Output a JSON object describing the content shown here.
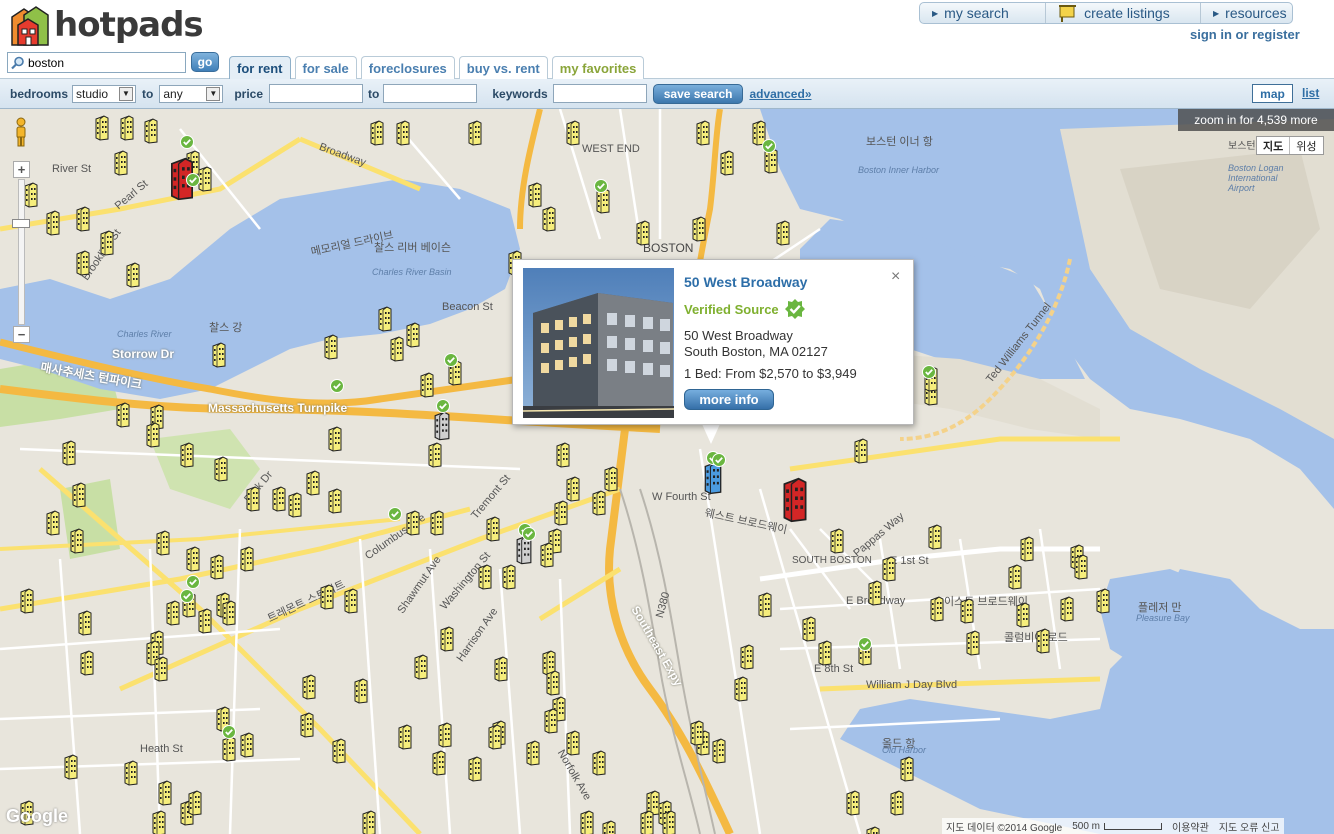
{
  "brand": {
    "name": "hotpads"
  },
  "topnav": {
    "items": [
      {
        "label": "my search"
      },
      {
        "label": "create listings"
      },
      {
        "label": "resources"
      }
    ],
    "signin": "sign in or register"
  },
  "search": {
    "value": "boston",
    "go_label": "go"
  },
  "tabs": [
    {
      "label": "for rent",
      "active": true
    },
    {
      "label": "for sale"
    },
    {
      "label": "foreclosures"
    },
    {
      "label": "buy vs. rent"
    },
    {
      "label": "my favorites"
    }
  ],
  "filters": {
    "bedrooms_label": "bedrooms",
    "bedrooms_from": "studio",
    "to_label": "to",
    "bedrooms_to": "any",
    "price_label": "price",
    "price_to_label": "to",
    "keywords_label": "keywords",
    "save_search_label": "save search",
    "advanced_label": "advanced»",
    "view_map_label": "map",
    "view_list_label": "list"
  },
  "map": {
    "zoom_message": "zoom in for 4,539 more",
    "map_type": {
      "map": "지도",
      "satellite": "위성"
    },
    "google": "Google",
    "attribution": "지도 데이터 ©2014 Google",
    "scale": "500 m",
    "terms": "이용약관",
    "report": "지도 오류 신고",
    "labels": [
      {
        "text": "BOSTON",
        "cls": "big"
      },
      {
        "text": "WEST END",
        "cls": ""
      },
      {
        "text": "SOUTH BOSTON",
        "cls": ""
      },
      {
        "text": "Charles River Basin",
        "cls": "water"
      },
      {
        "text": "찰스 리버 베이슨",
        "cls": ""
      },
      {
        "text": "Charles River",
        "cls": "water"
      },
      {
        "text": "찰스 강",
        "cls": ""
      },
      {
        "text": "보스턴 이너 항",
        "cls": ""
      },
      {
        "text": "Boston Inner Harbor",
        "cls": "water"
      },
      {
        "text": "보스턴 로건 국제공항",
        "cls": ""
      },
      {
        "text": "Boston Logan International Airport",
        "cls": "water"
      },
      {
        "text": "플레저 만",
        "cls": ""
      },
      {
        "text": "Pleasure Bay",
        "cls": "water"
      },
      {
        "text": "올드 항",
        "cls": ""
      },
      {
        "text": "Old Harbor",
        "cls": "water"
      },
      {
        "text": "Storrow Dr",
        "cls": "white"
      },
      {
        "text": "Massachusetts Turnpike",
        "cls": "white"
      },
      {
        "text": "Southeast Expy",
        "cls": "white"
      },
      {
        "text": "Ted Williams Tunnel",
        "cls": ""
      },
      {
        "text": "W Fourth St",
        "cls": ""
      },
      {
        "text": "E Broadway",
        "cls": ""
      },
      {
        "text": "E 1st St",
        "cls": ""
      },
      {
        "text": "E 8th St",
        "cls": ""
      },
      {
        "text": "William J Day Blvd",
        "cls": ""
      },
      {
        "text": "Pappas Way",
        "cls": ""
      },
      {
        "text": "Beacon St",
        "cls": ""
      },
      {
        "text": "Broadway",
        "cls": ""
      },
      {
        "text": "Heath St",
        "cls": ""
      },
      {
        "text": "Harrison Ave",
        "cls": ""
      },
      {
        "text": "Washington St",
        "cls": ""
      },
      {
        "text": "Tremont St",
        "cls": ""
      },
      {
        "text": "Norfolk Ave",
        "cls": ""
      },
      {
        "text": "Brookline St",
        "cls": ""
      },
      {
        "text": "River St",
        "cls": ""
      },
      {
        "text": "Pearl St",
        "cls": ""
      },
      {
        "text": "Park Dr",
        "cls": ""
      },
      {
        "text": "Shawmut Ave",
        "cls": ""
      },
      {
        "text": "Columbus Ave",
        "cls": ""
      },
      {
        "text": "메모리얼 드라이브",
        "cls": ""
      },
      {
        "text": "매사추세츠 턴파이크",
        "cls": ""
      },
      {
        "text": "트레몬트 스트리트",
        "cls": ""
      },
      {
        "text": "이스트 브로드웨이",
        "cls": ""
      },
      {
        "text": "웨스트 브로드웨이",
        "cls": ""
      },
      {
        "text": "콜럼비아 로드",
        "cls": ""
      },
      {
        "text": "N380",
        "cls": ""
      }
    ]
  },
  "popup": {
    "title": "50 West Broadway",
    "verified": "Verified Source",
    "address_line1": "50 West Broadway",
    "address_line2": "South Boston, MA 02127",
    "price": "1 Bed: From $2,570 to $3,949",
    "more_info": "more info",
    "close": "×"
  },
  "colors": {
    "water": "#a4c1e9",
    "land": "#e8e5dc",
    "park": "#c8dfa5",
    "highway": "#f4b942",
    "pin_yellow": "#f6ee7c",
    "pin_red": "#d32626",
    "pin_blue": "#4b9be0",
    "verified_green": "#6ab640"
  }
}
